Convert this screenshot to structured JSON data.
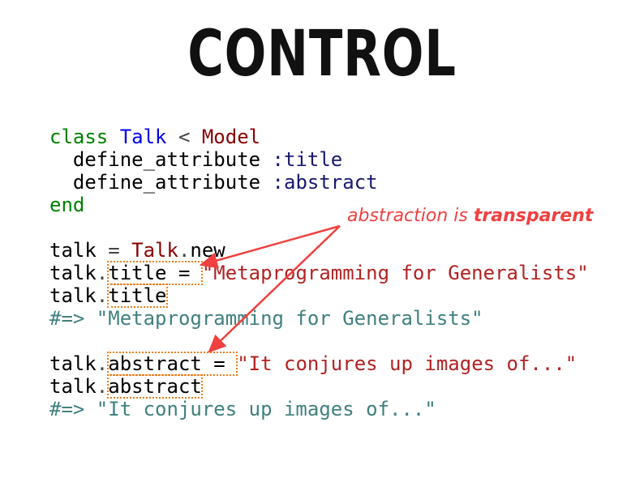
{
  "title": "CONTROL",
  "code": {
    "lines": [
      [
        {
          "t": "class",
          "c": "kw"
        },
        {
          "t": " "
        },
        {
          "t": "Talk",
          "c": "cls"
        },
        {
          "t": " < ",
          "c": "op"
        },
        {
          "t": "Model",
          "c": "const"
        }
      ],
      [
        {
          "t": "  define_attribute "
        },
        {
          "t": ":title",
          "c": "sym"
        }
      ],
      [
        {
          "t": "  define_attribute "
        },
        {
          "t": ":abstract",
          "c": "sym"
        }
      ],
      [
        {
          "t": "end",
          "c": "kw"
        }
      ],
      [],
      [
        {
          "t": "talk "
        },
        {
          "t": "=",
          "c": "op"
        },
        {
          "t": " "
        },
        {
          "t": "Talk",
          "c": "const"
        },
        {
          "t": ".",
          "c": "op"
        },
        {
          "t": "new"
        }
      ],
      [
        {
          "t": "talk"
        },
        {
          "t": ".",
          "c": "op"
        },
        {
          "t": "title = ",
          "b": true
        },
        {
          "t": "\"Metaprogramming for Generalists\"",
          "c": "str"
        }
      ],
      [
        {
          "t": "talk"
        },
        {
          "t": ".",
          "c": "op"
        },
        {
          "t": "title",
          "b": true
        }
      ],
      [
        {
          "t": "#=> \"Metaprogramming for Generalists\"",
          "c": "cmt"
        }
      ],
      [],
      [
        {
          "t": "talk"
        },
        {
          "t": ".",
          "c": "op"
        },
        {
          "t": "abstract = ",
          "b": true
        },
        {
          "t": "\"It conjures up images of...\"",
          "c": "str"
        }
      ],
      [
        {
          "t": "talk"
        },
        {
          "t": ".",
          "c": "op"
        },
        {
          "t": "abstract",
          "b": true
        }
      ],
      [
        {
          "t": "#=> \"It conjures up images of...\"",
          "c": "cmt"
        }
      ]
    ]
  },
  "annotation": {
    "text": "abstraction is ",
    "emphasis": "transparent",
    "color": "#f04040"
  },
  "colors": {
    "highlight_box": "#f07d1a",
    "arrow": "#f04040"
  }
}
